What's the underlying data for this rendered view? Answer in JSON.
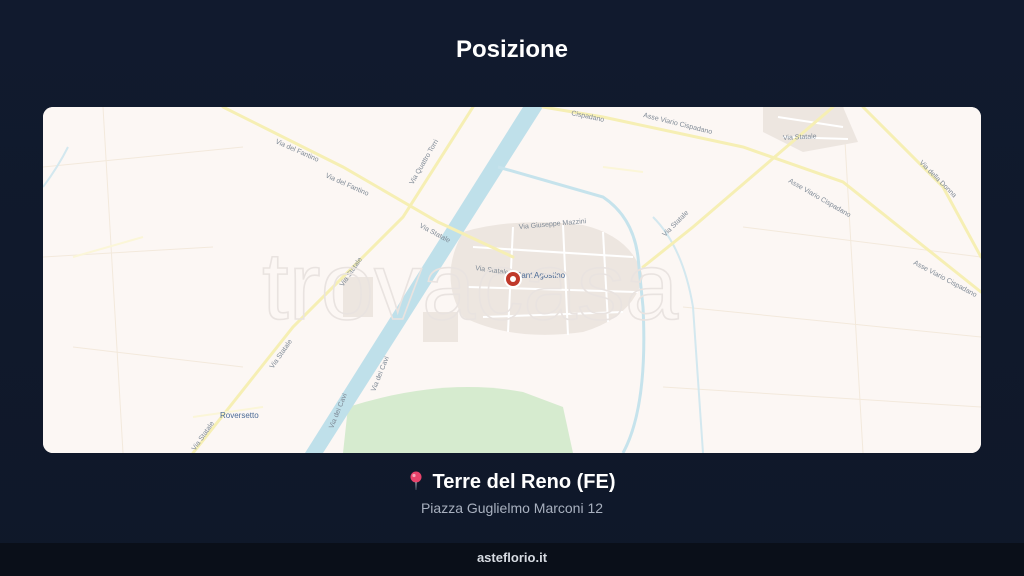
{
  "page": {
    "title": "Posizione"
  },
  "map": {
    "watermark": "trovacasa",
    "town_label": "Sant'Agostino",
    "place_label": "Roversetto",
    "road_labels": {
      "asse_1": "Asse Viario Cispadano",
      "asse_2": "Asse Viario Cispadano",
      "asse_3": "Asse Viario Cispadano",
      "asse_top": "Cispadano",
      "via_fantino_1": "Via del Fantino",
      "via_fantino_2": "Via del Fantino",
      "via_quattro_torri": "Via Quattro Torri",
      "via_statale_1": "Via Statale",
      "via_statale_2": "Via Statale",
      "via_statale_3": "Via Statale",
      "via_statale_4": "Via Statale",
      "via_statale_5": "Via Statale",
      "via_statale_6": "Via Statale",
      "via_statale_town": "Via Statale",
      "via_mazzini": "Via Giuseppe Mazzini",
      "via_dei_cavi_1": "Via dei Cavi",
      "via_dei_cavi_2": "Via dei Cavi",
      "via_della_donna": "Via della Donna"
    }
  },
  "location": {
    "name": "Terre del Reno (FE)",
    "address": "Piazza Guglielmo Marconi 12",
    "icon": "pushpin-icon"
  },
  "footer": {
    "site": "asteflorio.it"
  },
  "colors": {
    "background": "#111a2e",
    "map_background": "#fcf7f4",
    "canal": "#bfe0ea",
    "road": "#f6efb4",
    "park": "#d6ebcf",
    "marker": "#c0392b"
  }
}
